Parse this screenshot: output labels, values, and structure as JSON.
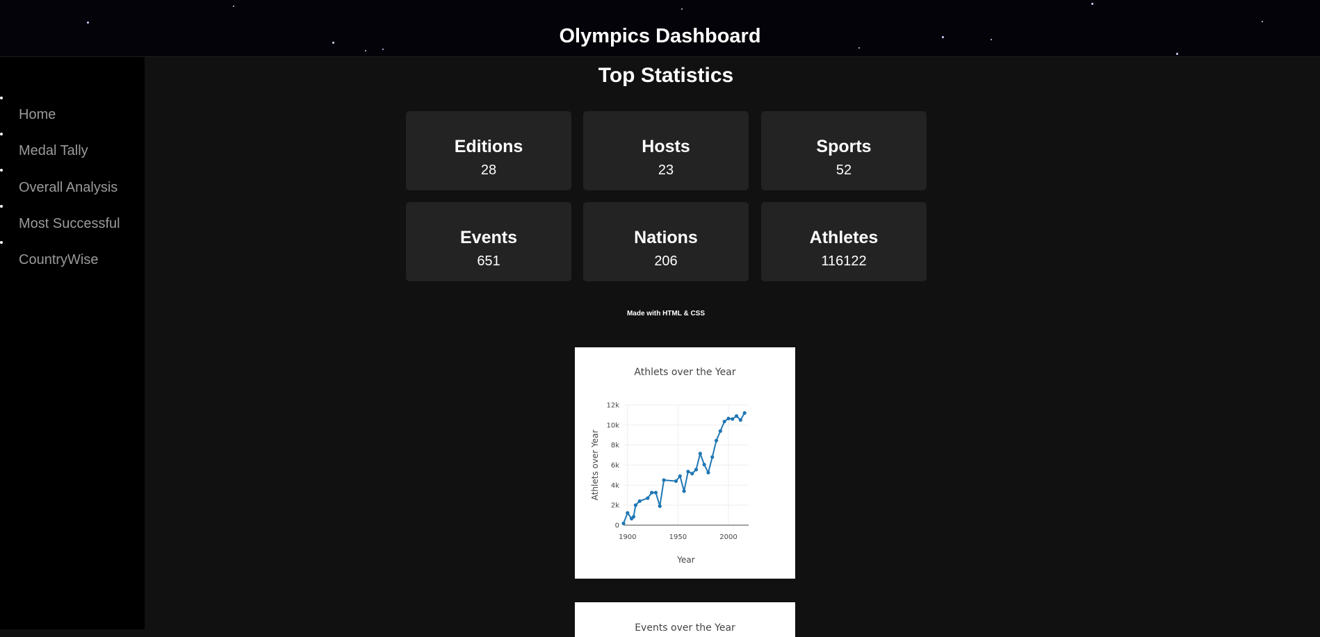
{
  "header": {
    "title": "Olympics Dashboard"
  },
  "sidebar": {
    "items": [
      {
        "label": "Home"
      },
      {
        "label": "Medal Tally"
      },
      {
        "label": "Overall Analysis"
      },
      {
        "label": "Most Successful"
      },
      {
        "label": "CountryWise"
      }
    ]
  },
  "stats": {
    "title": "Top Statistics",
    "cards": [
      {
        "label": "Editions",
        "value": "28"
      },
      {
        "label": "Hosts",
        "value": "23"
      },
      {
        "label": "Sports",
        "value": "52"
      },
      {
        "label": "Events",
        "value": "651"
      },
      {
        "label": "Nations",
        "value": "206"
      },
      {
        "label": "Athletes",
        "value": "116122"
      }
    ]
  },
  "footer_note": "Made with HTML & CSS",
  "chart_data": [
    {
      "type": "line",
      "title": "Athlets over the Year",
      "xlabel": "Year",
      "ylabel": "Athlets over Year",
      "xlim": [
        1896,
        2020
      ],
      "ylim": [
        0,
        12000
      ],
      "x_ticks": [
        1900,
        1950,
        2000
      ],
      "y_ticks": [
        0,
        2000,
        4000,
        6000,
        8000,
        10000,
        12000
      ],
      "x_tick_labels": [
        "1900",
        "1950",
        "2000"
      ],
      "y_tick_labels": [
        "0",
        "2k",
        "4k",
        "6k",
        "8k",
        "10k",
        "12k"
      ],
      "grid": true,
      "color": "#1f77b4",
      "x": [
        1896,
        1900,
        1904,
        1906,
        1908,
        1912,
        1920,
        1924,
        1928,
        1932,
        1936,
        1948,
        1952,
        1956,
        1960,
        1964,
        1968,
        1972,
        1976,
        1980,
        1984,
        1988,
        1992,
        1996,
        2000,
        2004,
        2008,
        2012,
        2016
      ],
      "y": [
        176,
        1220,
        650,
        841,
        2000,
        2400,
        2700,
        3250,
        3250,
        1900,
        4500,
        4400,
        4900,
        3400,
        5350,
        5150,
        5550,
        7150,
        6050,
        5250,
        6800,
        8450,
        9400,
        10350,
        10650,
        10600,
        10900,
        10500,
        11200
      ]
    },
    {
      "type": "line",
      "title": "Events over the Year"
    }
  ]
}
